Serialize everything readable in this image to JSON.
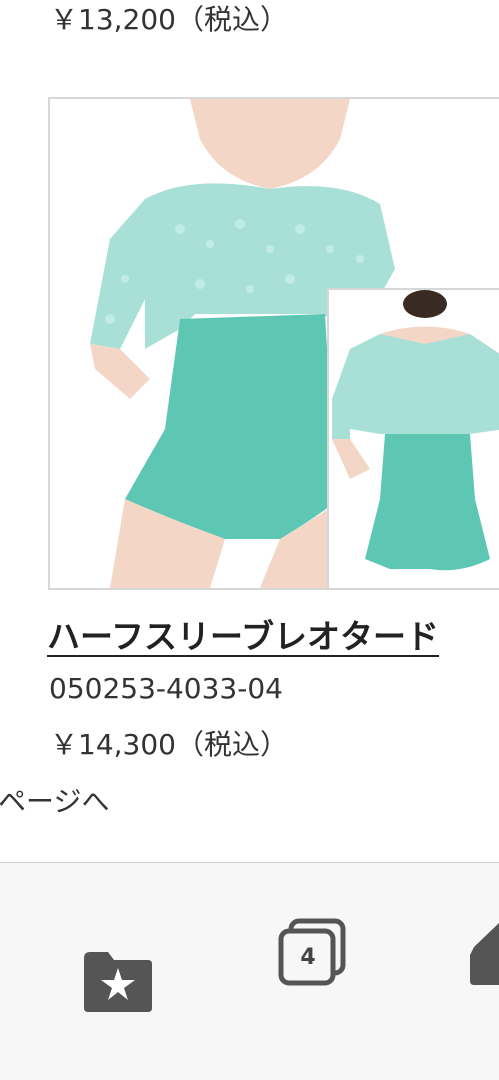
{
  "previous_item": {
    "price": "￥13,200（税込）"
  },
  "product": {
    "image_alt": "Half-sleeve leotard with mint lace top and teal body",
    "title": "ハーフスリーブレオタード",
    "code": "050253-4033-04",
    "price": "￥14,300（税込）"
  },
  "pagination": {
    "link_text": "ページへ"
  },
  "toolbar": {
    "bookmarks_icon": "bookmarks-icon",
    "tab_count": "4",
    "tabs_icon": "tabs-icon",
    "more_icon": "home-icon"
  },
  "colors": {
    "lace": "#a8e0d8",
    "body": "#5ec7b4",
    "skin": "#f3d6c6",
    "toolbar_bg": "#f7f7f7",
    "icon": "#555555"
  }
}
